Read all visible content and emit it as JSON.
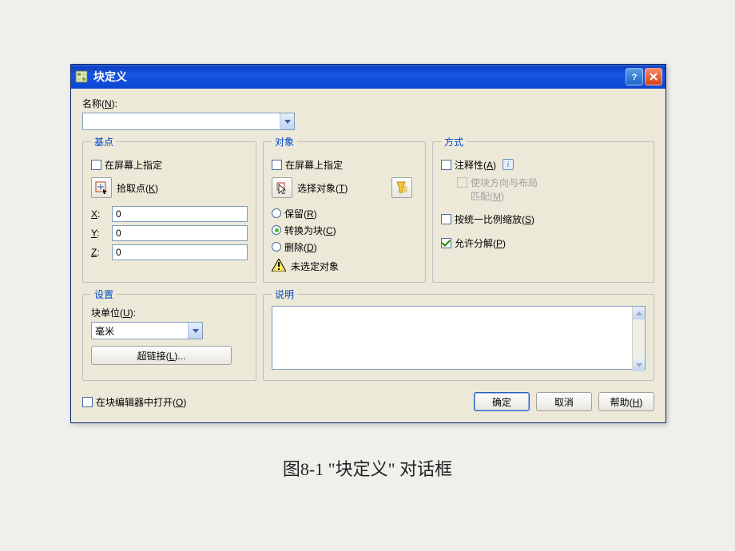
{
  "window": {
    "title": "块定义"
  },
  "name": {
    "label": "名称(N):",
    "value": ""
  },
  "basepoint": {
    "legend": "基点",
    "specifyOnScreen": "在屏幕上指定",
    "pickPoint": "拾取点(K)",
    "xLabel": "X:",
    "yLabel": "Y:",
    "zLabel": "Z:",
    "xValue": "0",
    "yValue": "0",
    "zValue": "0"
  },
  "objects": {
    "legend": "对象",
    "specifyOnScreen": "在屏幕上指定",
    "selectObjects": "选择对象(T)",
    "retain": "保留(R)",
    "convert": "转换为块(C)",
    "delete": "删除(D)",
    "noneSelected": "未选定对象"
  },
  "behavior": {
    "legend": "方式",
    "annotative": "注释性(A)",
    "matchOrientation": "使块方向与布局匹配(M)",
    "scaleUniform": "按统一比例缩放(S)",
    "allowExplode": "允许分解(P)"
  },
  "settings": {
    "legend": "设置",
    "blockUnitLabel": "块单位(U):",
    "blockUnitValue": "毫米",
    "hyperlinkLabel": "超链接(L)..."
  },
  "description": {
    "legend": "说明",
    "value": ""
  },
  "footer": {
    "openInEditor": "在块编辑器中打开(O)",
    "ok": "确定",
    "cancel": "取消",
    "help": "帮助(H)"
  },
  "caption": "图8-1  \"块定义\" 对话框"
}
